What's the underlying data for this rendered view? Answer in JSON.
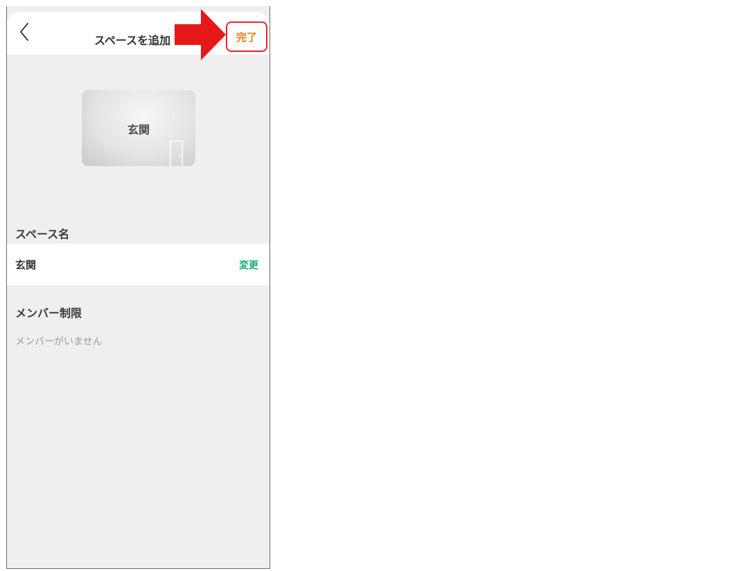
{
  "header": {
    "title": "スペースを追加",
    "done_label": "完了"
  },
  "card": {
    "label": "玄関",
    "icon": "door-icon"
  },
  "space_name": {
    "section_label": "スペース名",
    "value": "玄関",
    "change_label": "変更"
  },
  "member_limit": {
    "section_label": "メンバー制限",
    "empty_text": "メンバーがいません"
  },
  "colors": {
    "accent_orange": "#ef7a1a",
    "change_green": "#1aab72",
    "highlight_red": "#e8232a"
  }
}
